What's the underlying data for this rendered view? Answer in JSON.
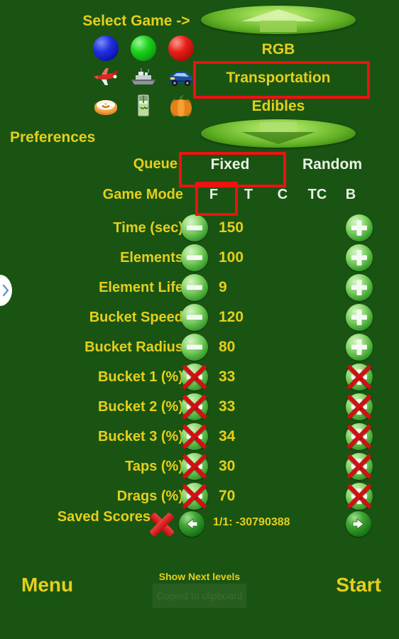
{
  "app": {
    "background_color": "#1a5413",
    "gold": "#e5cf1b",
    "white": "#e9f2e6",
    "annotation_color": "#ee1111"
  },
  "header": {
    "select_game_label": "Select Game ->",
    "preferences_label": "Preferences",
    "scroll_up_icon": "arrow-up-icon",
    "scroll_down_icon": "arrow-down-icon"
  },
  "categories": [
    {
      "name": "RGB",
      "icons": [
        "blue-ball-icon",
        "green-ball-icon",
        "red-ball-icon"
      ]
    },
    {
      "name": "Transportation",
      "icons": [
        "airplane-icon",
        "ship-icon",
        "car-icon"
      ]
    },
    {
      "name": "Edibles",
      "icons": [
        "cake-icon",
        "drink-icon",
        "pumpkin-icon"
      ]
    }
  ],
  "queue": {
    "label": "Queue",
    "options": [
      "Fixed",
      "Random"
    ],
    "selected": "Fixed"
  },
  "game_mode": {
    "label": "Game Mode",
    "options": [
      "F",
      "T",
      "C",
      "TC",
      "B"
    ],
    "selected": "F"
  },
  "settings": [
    {
      "label": "Time (sec)",
      "value": "150",
      "decrement_icon": "minus-icon",
      "increment_icon": "plus-icon",
      "disabled": false
    },
    {
      "label": "Elements",
      "value": "100",
      "decrement_icon": "minus-icon",
      "increment_icon": "plus-icon",
      "disabled": false
    },
    {
      "label": "Element Life",
      "value": "9",
      "decrement_icon": "minus-icon",
      "increment_icon": "plus-icon",
      "disabled": false
    },
    {
      "label": "Bucket Speed",
      "value": "120",
      "decrement_icon": "minus-icon",
      "increment_icon": "plus-icon",
      "disabled": false
    },
    {
      "label": "Bucket Radius",
      "value": "80",
      "decrement_icon": "minus-icon",
      "increment_icon": "plus-icon",
      "disabled": false
    },
    {
      "label": "Bucket 1 (%)",
      "value": "33",
      "decrement_icon": "minus-icon-disabled",
      "increment_icon": "plus-icon-disabled",
      "disabled": true
    },
    {
      "label": "Bucket 2 (%)",
      "value": "33",
      "decrement_icon": "minus-icon-disabled",
      "increment_icon": "plus-icon-disabled",
      "disabled": true
    },
    {
      "label": "Bucket 3 (%)",
      "value": "34",
      "decrement_icon": "minus-icon-disabled",
      "increment_icon": "plus-icon-disabled",
      "disabled": true
    },
    {
      "label": "Taps (%)",
      "value": "30",
      "decrement_icon": "minus-icon-disabled",
      "increment_icon": "plus-icon-disabled",
      "disabled": true
    },
    {
      "label": "Drags (%)",
      "value": "70",
      "decrement_icon": "minus-icon-disabled",
      "increment_icon": "plus-icon-disabled",
      "disabled": true
    }
  ],
  "saved_scores": {
    "label": "Saved Scores",
    "delete_icon": "red-x-icon",
    "prev_icon": "arrow-left-icon",
    "next_icon": "arrow-right-icon",
    "text": "1/1: -30790388"
  },
  "footer": {
    "menu_label": "Menu",
    "start_label": "Start",
    "next_levels_label": "Show Next levels",
    "toast_text": "Copied to clipboard"
  },
  "drawer": {
    "handle_icon": "chevron-right-icon"
  }
}
